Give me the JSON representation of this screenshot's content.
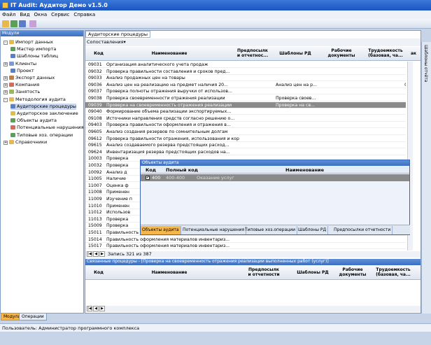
{
  "window": {
    "title": "IT Audit: Аудитор Демо v1.5.0"
  },
  "menu": [
    "Файл",
    "Вид",
    "Окна",
    "Сервис",
    "Справка"
  ],
  "left_panel": {
    "title": "Модули",
    "tree": [
      {
        "label": "Импорт данных",
        "expander": "-"
      },
      {
        "label": "Мастер импорта"
      },
      {
        "label": "Шаблоны таблиц"
      },
      {
        "label": "Клиенты",
        "expander": "+"
      },
      {
        "label": "Проект"
      },
      {
        "label": "Экспорт данных",
        "expander": "+"
      },
      {
        "label": "Компания",
        "expander": "+"
      },
      {
        "label": "Занятость",
        "expander": "+"
      },
      {
        "label": "Методология аудита",
        "expander": "-"
      },
      {
        "label": "Аудиторские процедуры"
      },
      {
        "label": "Аудиторское заключение"
      },
      {
        "label": "Объекты аудита"
      },
      {
        "label": "Потенциальные нарушения"
      },
      {
        "label": "Типовые хоз. операции"
      },
      {
        "label": "Справочники",
        "expander": "+"
      }
    ],
    "tabs": [
      "Модули",
      "Операции"
    ]
  },
  "main": {
    "tab": "Аудиторские процедуры",
    "toolbar_label": "Сопоставления",
    "columns": [
      "Код",
      "Наименование",
      "Предпосылк и отчетнос...",
      "Шаблоны РД",
      "Рабочие документы",
      "Трудоемкость (базовая, ча...",
      "ак"
    ],
    "rows": [
      {
        "code": "09031",
        "name": "Организация аналитического учета продаж",
        "tpl": "",
        "work": "",
        "hours": ""
      },
      {
        "code": "09032",
        "name": "Проверка правильности составления и сроков пред...",
        "tpl": "",
        "work": "",
        "hours": ""
      },
      {
        "code": "09033",
        "name": "Анализ продажных цен на товары",
        "tpl": "",
        "work": "",
        "hours": ""
      },
      {
        "code": "09036",
        "name": "Анализ цен на реализацию на предмет наличия 20...",
        "tpl": "Анализ цен на р...",
        "work": "",
        "hours": "0"
      },
      {
        "code": "09037",
        "name": "Проверка полноты отражения выручки от использов...",
        "tpl": "",
        "work": "",
        "hours": ""
      },
      {
        "code": "09038",
        "name": "Проверка своевременности отражения реализации",
        "tpl": "Проверка своев...",
        "work": "",
        "hours": ""
      },
      {
        "code": "09039",
        "name": "Проверка на своевременность отражения реализации",
        "tpl": "Проверка на св...",
        "work": "",
        "hours": "",
        "selected": true
      },
      {
        "code": "09040",
        "name": "Формирование объема реализации экспортируемых...",
        "tpl": "",
        "work": "",
        "hours": ""
      },
      {
        "code": "09108",
        "name": "Источники направления средств согласно решению о...",
        "tpl": "",
        "work": "",
        "hours": ""
      },
      {
        "code": "09403",
        "name": "Проверка правильности оформления и отражения в...",
        "tpl": "",
        "work": "",
        "hours": ""
      },
      {
        "code": "09605",
        "name": "Анализ создания резервов по сомнительным долгам",
        "tpl": "",
        "work": "",
        "hours": ""
      },
      {
        "code": "09612",
        "name": "Проверка правильности отражения, использования и корре...",
        "tpl": "",
        "work": "",
        "hours": ""
      },
      {
        "code": "09615",
        "name": "Анализ создаваемого резерва предстоящих расход...",
        "tpl": "",
        "work": "",
        "hours": ""
      },
      {
        "code": "09624",
        "name": "Инвентаризация резерва предстоящих расходов на...",
        "tpl": "",
        "work": "",
        "hours": ""
      },
      {
        "code": "10003",
        "name": "Проверка",
        "tpl": "",
        "work": "",
        "hours": ""
      },
      {
        "code": "10032",
        "name": "Проверка",
        "tpl": "",
        "work": "",
        "hours": ""
      },
      {
        "code": "10092",
        "name": "Анализ д",
        "tpl": "",
        "work": "",
        "hours": ""
      },
      {
        "code": "11005",
        "name": "Наличие",
        "tpl": "",
        "work": "",
        "hours": ""
      },
      {
        "code": "11007",
        "name": "Оценка ф",
        "tpl": "",
        "work": "",
        "hours": ""
      },
      {
        "code": "11008",
        "name": "Применен",
        "tpl": "",
        "work": "",
        "hours": ""
      },
      {
        "code": "11009",
        "name": "Изучение п",
        "tpl": "",
        "work": "",
        "hours": ""
      },
      {
        "code": "11010",
        "name": "Применен",
        "tpl": "",
        "work": "",
        "hours": ""
      },
      {
        "code": "11012",
        "name": "Использов",
        "tpl": "",
        "work": "",
        "hours": ""
      },
      {
        "code": "11013",
        "name": "Проверка",
        "tpl": "",
        "work": "",
        "hours": ""
      },
      {
        "code": "15009",
        "name": "Проверка",
        "tpl": "",
        "work": "",
        "hours": ""
      },
      {
        "code": "15011",
        "name": "Правильность оформления материалов инвентариз...",
        "tpl": "",
        "work": "",
        "hours": ""
      },
      {
        "code": "15014",
        "name": "Правильность оформления материалов инвентариз...",
        "tpl": "",
        "work": "",
        "hours": ""
      },
      {
        "code": "15017",
        "name": "Правильность оформления материалов инвентариз...",
        "tpl": "",
        "work": "",
        "hours": ""
      }
    ],
    "record_nav": "Запись 321 из 387",
    "popup": {
      "title": "Объекты аудита",
      "columns": [
        "Код",
        "Полный код",
        "Наименование"
      ],
      "row": {
        "code": "400",
        "full": "400-400",
        "name": "Оказание услуг"
      },
      "tabs": [
        "Объекты аудита",
        "Потенциальные нарушения",
        "Типовые хоз.операции",
        "Шаблоны РД",
        "Предпосылки отчетности"
      ]
    },
    "related_title": "Связанные процедуры - [Проверка на своевременность отражения реализации выполненных работ (услуг)]",
    "related_columns": [
      "Код",
      "Наименование",
      "Предпосылк и отчетности",
      "Шаблоны РД",
      "Рабочие документы",
      "Трудоемкость (базовая, ча..."
    ]
  },
  "right_rail": "Шаблоны отчёта",
  "status": "Пользователь: Администратор программного комплекса"
}
